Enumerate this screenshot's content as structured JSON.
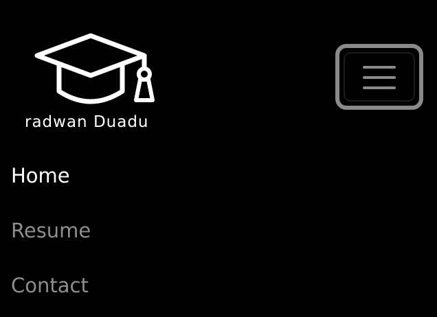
{
  "brand": {
    "name": "radwan Duadu",
    "logo_icon": "graduation-cap-icon"
  },
  "toggler": {
    "icon": "hamburger-menu-icon"
  },
  "nav": {
    "items": [
      {
        "label": "Home",
        "active": true
      },
      {
        "label": "Resume",
        "active": false
      },
      {
        "label": "Contact",
        "active": false
      }
    ]
  },
  "colors": {
    "background": "#000000",
    "active_link": "#ffffff",
    "inactive_link": "#8e8e8e",
    "toggler_border": "#8a8a8a"
  }
}
